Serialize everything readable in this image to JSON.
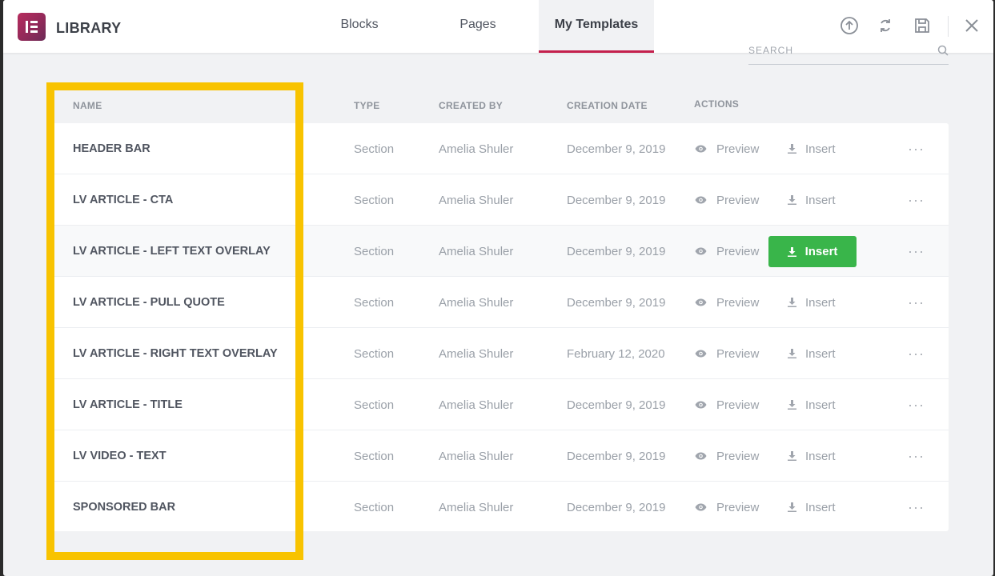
{
  "header": {
    "title": "LIBRARY",
    "tabs": [
      {
        "label": "Blocks"
      },
      {
        "label": "Pages"
      },
      {
        "label": "My Templates"
      }
    ],
    "accent_color": "#c4204d"
  },
  "search": {
    "placeholder": "SEARCH"
  },
  "columns": {
    "name": "NAME",
    "type": "TYPE",
    "created_by": "CREATED BY",
    "creation_date": "CREATION DATE",
    "actions": "ACTIONS"
  },
  "actions": {
    "preview": "Preview",
    "insert": "Insert",
    "more": "···"
  },
  "rows": [
    {
      "name": "HEADER BAR",
      "type": "Section",
      "author": "Amelia Shuler",
      "date": "December 9, 2019"
    },
    {
      "name": "LV ARTICLE - CTA",
      "type": "Section",
      "author": "Amelia Shuler",
      "date": "December 9, 2019"
    },
    {
      "name": "LV ARTICLE - LEFT TEXT OVERLAY",
      "type": "Section",
      "author": "Amelia Shuler",
      "date": "December 9, 2019"
    },
    {
      "name": "LV ARTICLE - PULL QUOTE",
      "type": "Section",
      "author": "Amelia Shuler",
      "date": "December 9, 2019"
    },
    {
      "name": "LV ARTICLE - RIGHT TEXT OVERLAY",
      "type": "Section",
      "author": "Amelia Shuler",
      "date": "February 12, 2020"
    },
    {
      "name": "LV ARTICLE - TITLE",
      "type": "Section",
      "author": "Amelia Shuler",
      "date": "December 9, 2019"
    },
    {
      "name": "LV VIDEO - TEXT",
      "type": "Section",
      "author": "Amelia Shuler",
      "date": "December 9, 2019"
    },
    {
      "name": "SPONSORED BAR",
      "type": "Section",
      "author": "Amelia Shuler",
      "date": "December 9, 2019"
    }
  ],
  "colors": {
    "insert_button": "#39b54a",
    "highlight_frame": "#f8c300"
  },
  "icons": {
    "logo": "elementor-logo-icon",
    "upload": "upload-icon",
    "sync": "sync-icon",
    "save": "save-icon",
    "close": "close-icon",
    "search": "search-icon",
    "preview": "eye-icon",
    "insert": "download-icon",
    "more": "ellipsis-icon"
  }
}
